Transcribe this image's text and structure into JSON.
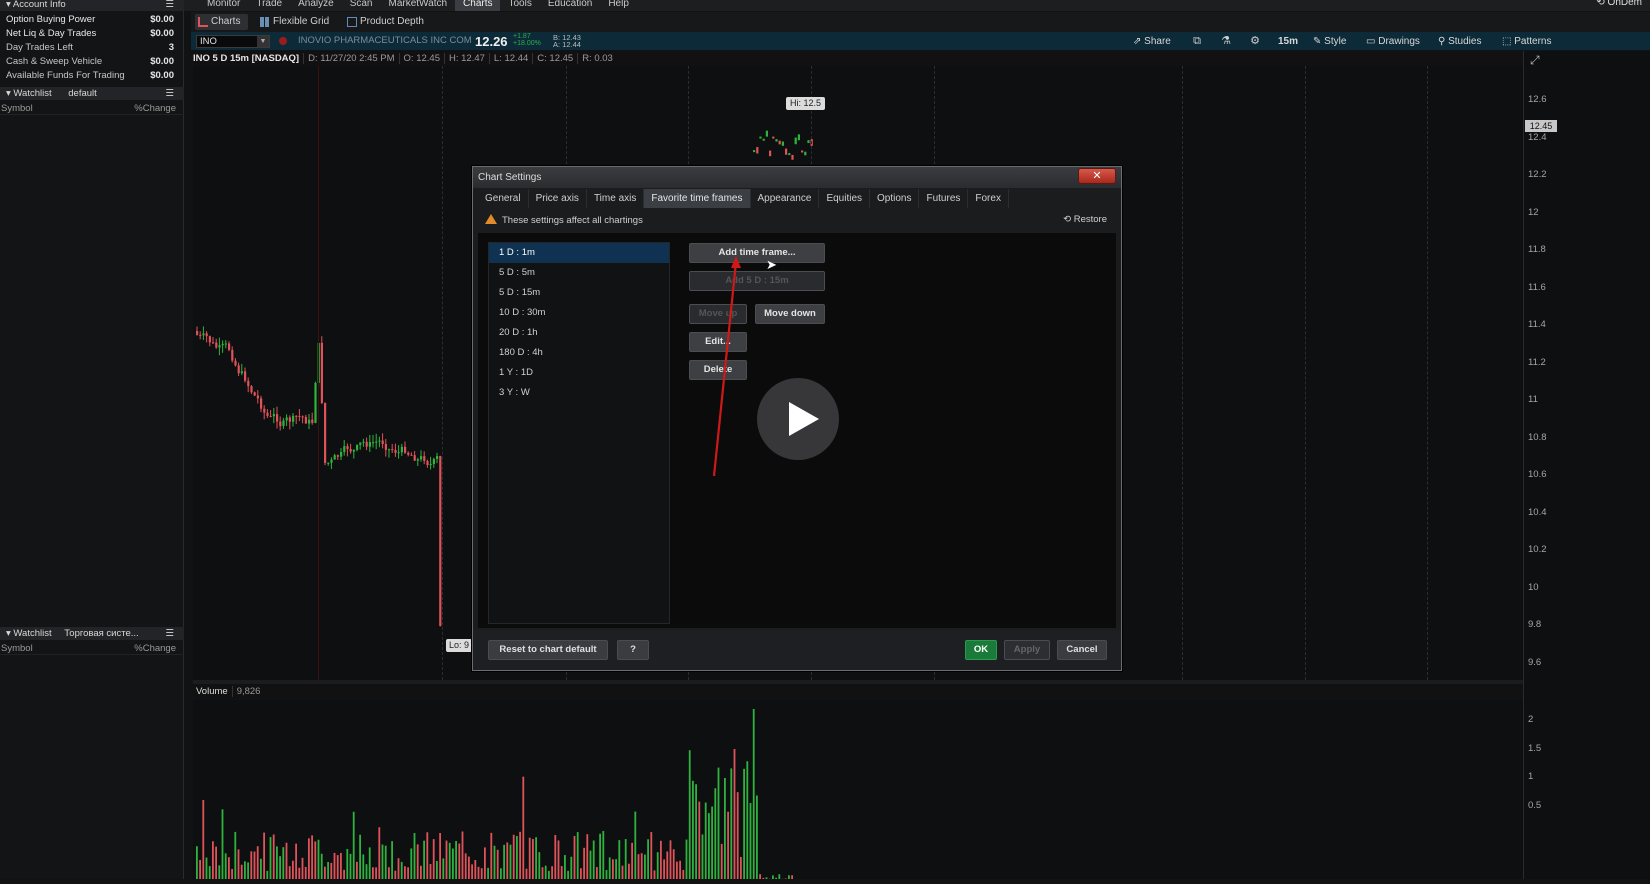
{
  "menubar": {
    "items": [
      "Monitor",
      "Trade",
      "Analyze",
      "Scan",
      "MarketWatch",
      "Charts",
      "Tools",
      "Education",
      "Help"
    ],
    "active": "Charts",
    "ondemand": "OnDem"
  },
  "account": {
    "header": "Account Info",
    "rows": [
      {
        "label": "Option Buying Power",
        "value": "$0.00"
      },
      {
        "label": "Net Liq & Day Trades",
        "value": "$0.00"
      },
      {
        "label": "Day Trades Left",
        "value": "3"
      },
      {
        "label": "Cash & Sweep Vehicle",
        "value": "$0.00"
      },
      {
        "label": "Available Funds For Trading",
        "value": "$0.00"
      }
    ]
  },
  "watchlist1": {
    "header": "Watchlist",
    "name": "default",
    "col_symbol": "Symbol",
    "col_change": "%Change"
  },
  "watchlist2": {
    "header": "Watchlist",
    "name": "Торговая систе...",
    "col_symbol": "Symbol",
    "col_change": "%Change"
  },
  "subtoolbar": {
    "tabs": [
      "Charts",
      "Flexible Grid",
      "Product Depth"
    ],
    "active": "Charts"
  },
  "symbolbar": {
    "symbol": "INO",
    "company": "INOVIO PHARMACEUTICALS INC COM",
    "last": "12.26",
    "chg_abs": "+1.87",
    "chg_pct": "+18.00%",
    "bid": "B: 12.43",
    "ask": "A: 12.44"
  },
  "toolbar": {
    "share": "Share",
    "timeframe": "15m",
    "style": "Style",
    "drawings": "Drawings",
    "studies": "Studies",
    "patterns": "Patterns"
  },
  "chartinfo": {
    "title": "INO 5 D 15m [NASDAQ]",
    "date": "D: 11/27/20 2:45 PM",
    "open": "O: 12.45",
    "high": "H: 12.47",
    "low": "L: 12.44",
    "close": "C: 12.45",
    "range": "R: 0.03"
  },
  "chart": {
    "hi": "Hi: 12.5",
    "lo": "Lo: 9",
    "price_tag": "12.45",
    "yticks": [
      "12.6",
      "12.4",
      "12.2",
      "12",
      "11.8",
      "11.6",
      "11.4",
      "11.2",
      "11",
      "10.8",
      "10.6",
      "10.4",
      "10.2",
      "10",
      "9.8",
      "9.6"
    ],
    "vol_label": "Volume",
    "vol_value": "9,826",
    "vol_ticks": [
      "2",
      "1.5",
      "1",
      "0.5"
    ]
  },
  "dialog": {
    "title": "Chart Settings",
    "tabs": [
      "General",
      "Price axis",
      "Time axis",
      "Favorite time frames",
      "Appearance",
      "Equities",
      "Options",
      "Futures",
      "Forex"
    ],
    "active_tab": "Favorite time frames",
    "warning": "These settings affect all chartings",
    "restore": "Restore",
    "timeframes": [
      "1 D : 1m",
      "5 D : 5m",
      "5 D : 15m",
      "10 D : 30m",
      "20 D : 1h",
      "180 D : 4h",
      "1 Y : 1D",
      "3 Y : W"
    ],
    "selected": "1 D : 1m",
    "btn_add": "Add time frame...",
    "btn_add_current": "Add 5 D : 15m",
    "btn_move_up": "Move up",
    "btn_move_down": "Move down",
    "btn_edit": "Edit...",
    "btn_delete": "Delete",
    "btn_reset": "Reset to chart default",
    "btn_help": "?",
    "btn_ok": "OK",
    "btn_apply": "Apply",
    "btn_cancel": "Cancel"
  },
  "colors": {
    "up": "#2fb33f",
    "down": "#e0535a",
    "accent": "#0f3252",
    "ok": "#1a7a3a"
  }
}
